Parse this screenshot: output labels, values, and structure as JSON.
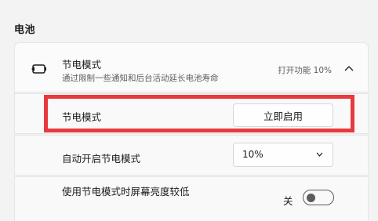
{
  "section": {
    "title": "电池"
  },
  "battery_saver": {
    "title": "节电模式",
    "subtitle": "通过限制一些通知和后台活动延长电池寿命",
    "status": "打开功能 10%",
    "icon": "battery-saver-icon",
    "rows": {
      "saver_now": {
        "label": "节电模式",
        "button_label": "立即启用"
      },
      "auto_on": {
        "label": "自动开启节电模式",
        "dropdown_value": "10%"
      },
      "brightness": {
        "label": "使用节电模式时屏幕亮度较低",
        "toggle_label": "关",
        "toggle_on": false
      }
    }
  },
  "colors": {
    "highlight": "#e8393c"
  }
}
